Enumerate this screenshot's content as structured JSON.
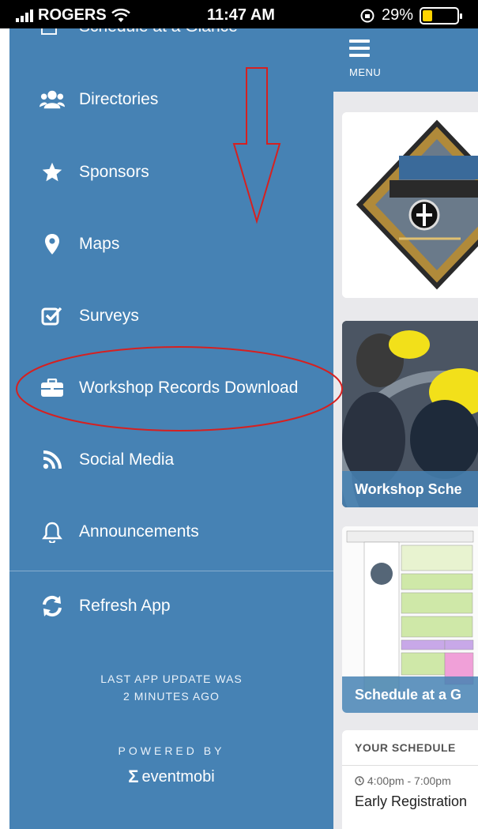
{
  "status_bar": {
    "carrier": "ROGERS",
    "time": "11:47 AM",
    "battery_percent": "29%",
    "battery_level": 0.29
  },
  "drawer": {
    "partial_item_label": "Schedule at a Glance",
    "items": [
      {
        "label": "Directories",
        "icon": "users-icon"
      },
      {
        "label": "Sponsors",
        "icon": "star-icon"
      },
      {
        "label": "Maps",
        "icon": "map-marker-icon"
      },
      {
        "label": "Surveys",
        "icon": "checkbox-icon"
      },
      {
        "label": "Workshop Records Download",
        "icon": "briefcase-icon"
      },
      {
        "label": "Social Media",
        "icon": "rss-icon"
      },
      {
        "label": "Announcements",
        "icon": "bell-icon"
      }
    ],
    "refresh_label": "Refresh App",
    "last_update_line1": "LAST APP UPDATE WAS",
    "last_update_line2": "2 MINUTES AGO",
    "powered_by": "POWERED BY",
    "brand": "eventmobi"
  },
  "header": {
    "menu_label": "MENU"
  },
  "cards": {
    "workshop_schedule": "Workshop Sche",
    "schedule_glance": "Schedule at a G"
  },
  "your_schedule": {
    "heading": "YOUR SCHEDULE",
    "time": "4:00pm - 7:00pm",
    "title": "Early Registration"
  },
  "colors": {
    "drawer_bg": "#4682b4",
    "annotation_red": "#d62020"
  }
}
